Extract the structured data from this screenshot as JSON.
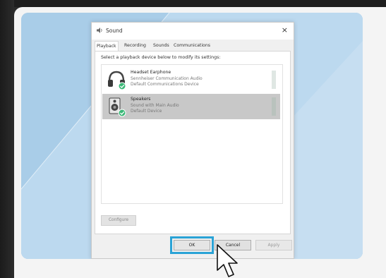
{
  "dialog": {
    "title": "Sound",
    "close_glyph": "×",
    "tabs": [
      "Playback",
      "Recording",
      "Sounds",
      "Communications"
    ],
    "active_tab": "Playback",
    "instruction": "Select a playback device below to modify its settings:",
    "devices": [
      {
        "name": "Headset Earphone",
        "description": "Sennheiser Communication Audio",
        "status": "Default Communications Device",
        "icon": "headset-icon",
        "selected": false
      },
      {
        "name": "Speakers",
        "description": "Sound with Main Audio",
        "status": "Default Device",
        "icon": "speaker-icon",
        "selected": true
      }
    ],
    "buttons": {
      "configure": "Configure",
      "ok": "OK",
      "cancel": "Cancel",
      "apply": "Apply"
    }
  },
  "colors": {
    "highlight": "#2aa3d6",
    "panel": "#a9cde8",
    "check": "#3cb878"
  }
}
